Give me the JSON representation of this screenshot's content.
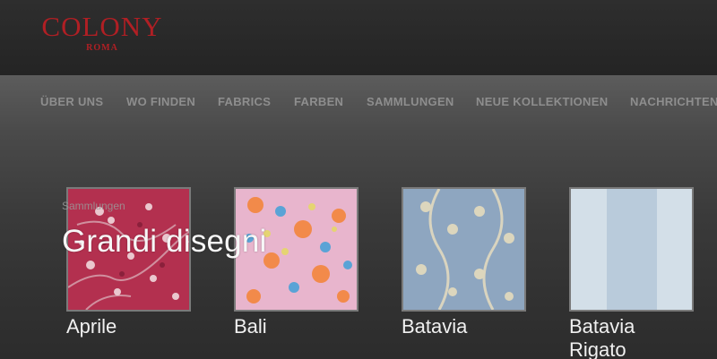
{
  "brand": {
    "name": "COLONY",
    "city": "ROMA"
  },
  "nav": {
    "items": [
      {
        "label": "ÜBER UNS"
      },
      {
        "label": "WO FINDEN"
      },
      {
        "label": "FABRICS"
      },
      {
        "label": "FARBEN"
      },
      {
        "label": "SAMMLUNGEN"
      },
      {
        "label": "NEUE KOLLEKTIONEN"
      },
      {
        "label": "NACHRICHTEN"
      }
    ]
  },
  "collection": {
    "breadcrumb": "Sammlungen",
    "title": "Grandi disegni",
    "fabrics": [
      {
        "name": "Aprile",
        "swatch_color": "#b73a58"
      },
      {
        "name": "Bali",
        "swatch_color": "#e9b6cf"
      },
      {
        "name": "Batavia",
        "swatch_color": "#8ea7c2"
      },
      {
        "name": "Batavia Rigato",
        "swatch_color": "#c7d6e2"
      }
    ]
  },
  "colors": {
    "brand_red": "#b01f24",
    "nav_text": "#8e8e8e",
    "header_bg": "#2a2a2a"
  }
}
